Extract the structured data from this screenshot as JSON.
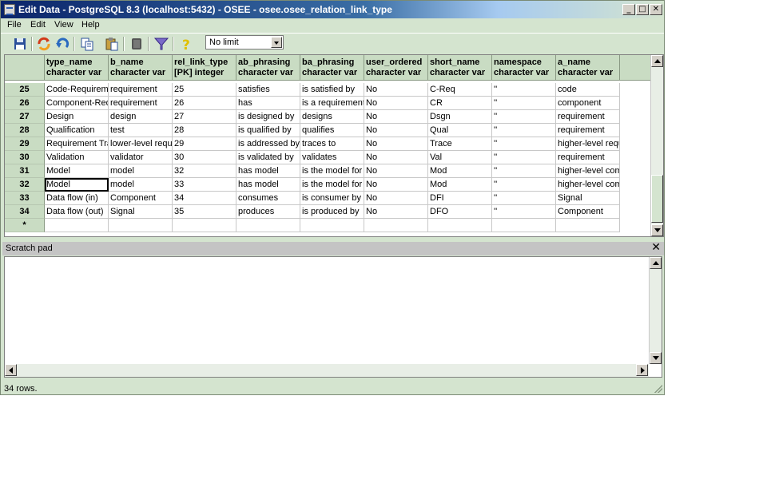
{
  "window": {
    "title": "Edit Data - PostgreSQL 8.3 (localhost:5432) - OSEE - osee.osee_relation_link_type"
  },
  "menu": [
    "File",
    "Edit",
    "View",
    "Help"
  ],
  "toolbar": {
    "limit_value": "No limit"
  },
  "icons": [
    "save-icon",
    "refresh-icon",
    "undo-icon",
    "copy-icon",
    "paste-icon",
    "delete-icon",
    "filter-icon",
    "help-icon"
  ],
  "grid": {
    "columns": [
      {
        "name": "type_name",
        "type": "character var"
      },
      {
        "name": "b_name",
        "type": "character var"
      },
      {
        "name": "rel_link_type",
        "type": "[PK] integer"
      },
      {
        "name": "ab_phrasing",
        "type": "character var"
      },
      {
        "name": "ba_phrasing",
        "type": "character var"
      },
      {
        "name": "user_ordered",
        "type": "character var"
      },
      {
        "name": "short_name",
        "type": "character var"
      },
      {
        "name": "namespace",
        "type": "character var"
      },
      {
        "name": "a_name",
        "type": "character var"
      }
    ],
    "rows": [
      {
        "num": "25",
        "cells": [
          "Code-Requireme",
          "requirement",
          "25",
          "satisfies",
          "is satisfied by",
          "No",
          "C-Req",
          "''",
          "code"
        ]
      },
      {
        "num": "26",
        "cells": [
          "Component-Req",
          "requirement",
          "26",
          "has",
          "is a requirement",
          "No",
          "CR",
          "''",
          "component"
        ]
      },
      {
        "num": "27",
        "cells": [
          "Design",
          "design",
          "27",
          "is designed by",
          "designs",
          "No",
          "Dsgn",
          "''",
          "requirement"
        ]
      },
      {
        "num": "28",
        "cells": [
          "Qualification",
          "test",
          "28",
          "is qualified by",
          "qualifies",
          "No",
          "Qual",
          "''",
          "requirement"
        ]
      },
      {
        "num": "29",
        "cells": [
          "Requirement Tra",
          "lower-level requ",
          "29",
          "is addressed by",
          "traces to",
          "No",
          "Trace",
          "''",
          "higher-level requ"
        ]
      },
      {
        "num": "30",
        "cells": [
          "Validation",
          "validator",
          "30",
          "is validated by",
          "validates",
          "No",
          "Val",
          "''",
          "requirement"
        ]
      },
      {
        "num": "31",
        "cells": [
          "Model",
          "model",
          "32",
          "has model",
          "is the model for",
          "No",
          "Mod",
          "''",
          "higher-level com"
        ]
      },
      {
        "num": "32",
        "cells": [
          "Model",
          "model",
          "33",
          "has model",
          "is the model for",
          "No",
          "Mod",
          "''",
          "higher-level com"
        ]
      },
      {
        "num": "33",
        "cells": [
          "Data flow (in)",
          "Component",
          "34",
          "consumes",
          "is consumer by",
          "No",
          "DFI",
          "''",
          "Signal"
        ]
      },
      {
        "num": "34",
        "cells": [
          "Data flow (out)",
          "Signal",
          "35",
          "produces",
          "is produced by",
          "No",
          "DFO",
          "''",
          "Component"
        ]
      }
    ],
    "new_row_marker": "*"
  },
  "scratch": {
    "title": "Scratch pad",
    "close": "✕"
  },
  "status": {
    "text": "34 rows."
  },
  "colors": {
    "window_bg": "#d4e4cf",
    "header_bg": "#c9dcc3",
    "title_start": "#0a246a"
  }
}
